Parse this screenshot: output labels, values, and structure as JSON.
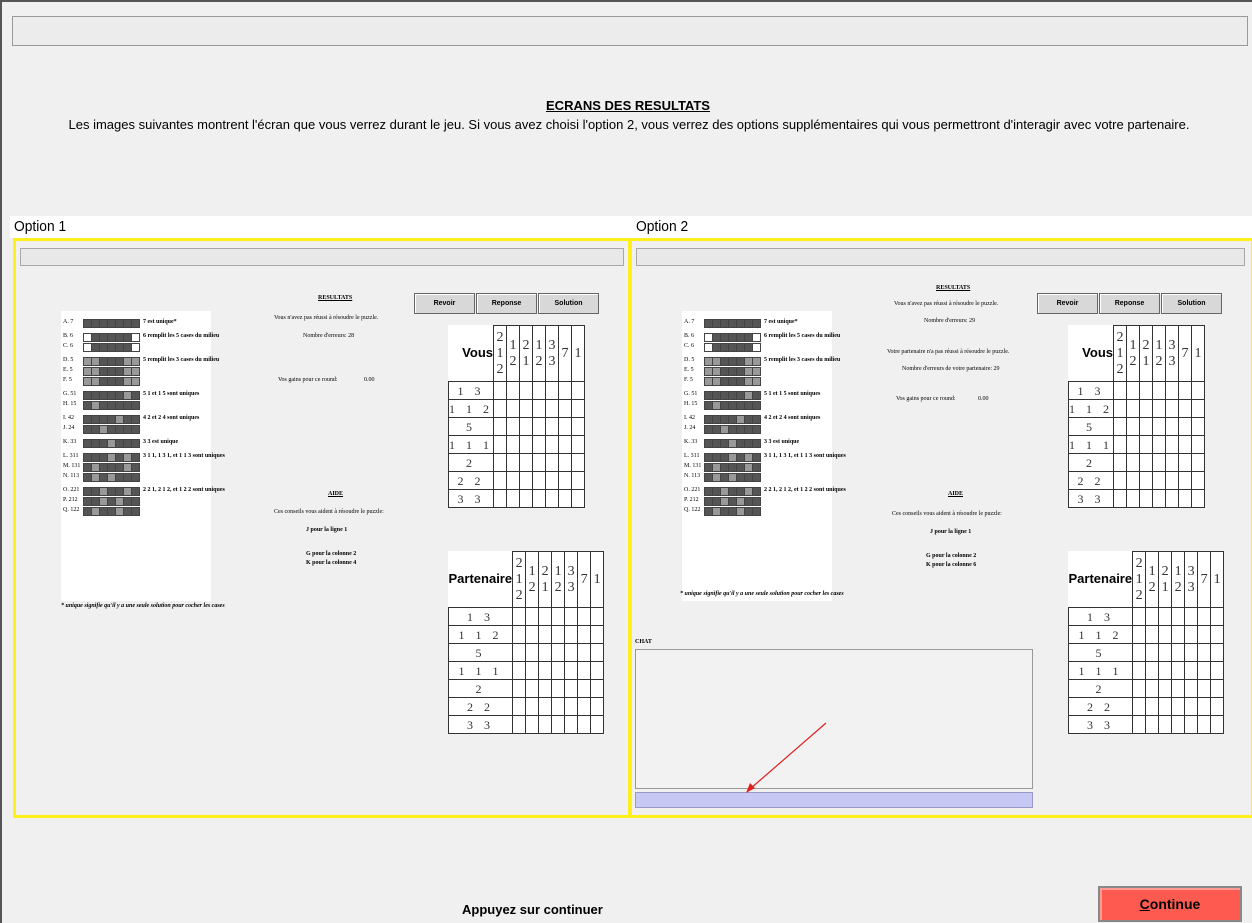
{
  "header": {
    "title": "ECRANS DES RESULTATS",
    "intro": "Les images suivantes montrent l'écran que vous verrez durant le jeu. Si vous avez choisi l'option 2, vous verrez des options supplémentaires qui vous permettront d'interagir avec votre partenaire."
  },
  "options": {
    "option1_label": "Option 1",
    "option2_label": "Option 2"
  },
  "screen": {
    "results_title": "RESULTATS",
    "not_solved": "Vous n'avez pas réussi à résoudre le puzzle.",
    "errors_label": "Nombre d'erreurs:",
    "errors_value_1": "28",
    "errors_value_2": "29",
    "partner_not_solved": "Votre partenaire n'a pas réussi à résoudre le puzzle.",
    "partner_errors": "Nombre d'erreurs de votre partenaire: 29",
    "earnings_label": "Vos gains pour ce round:",
    "earnings_value_1": "0.00",
    "earnings_value_2": "0.00",
    "aid_title": "AIDE",
    "aid_text": "Ces conseils vous aident à résoudre le puzzle:",
    "hint1": "J pour la ligne 1",
    "hint2": "G pour la colonne 2",
    "hint3_1": "K pour la colonne 4",
    "hint3_2": "K pour la colonne 6",
    "btn_review": "Revoir",
    "btn_response": "Reponse",
    "btn_solution": "Solution",
    "you_label": "Vous",
    "partner_label": "Partenaire",
    "chat_label": "CHAT",
    "footnote_1": "* unique signifie qu'il y a une seule solution pour cocher les cases",
    "footnote_2": "* unique signifie qu'il y a une seule solution pour cocher les cases"
  },
  "legend": [
    {
      "row": "A.",
      "num": "7",
      "desc": "7 est unique*"
    },
    {
      "row": "B.",
      "num": "6",
      "desc": "6 remplit les 5 cases du milieu"
    },
    {
      "row": "C.",
      "num": "6",
      "desc": ""
    },
    {
      "row": "D.",
      "num": "5",
      "desc": "5 remplit les 3 cases du milieu"
    },
    {
      "row": "E.",
      "num": "5",
      "desc": ""
    },
    {
      "row": "F.",
      "num": "5",
      "desc": ""
    },
    {
      "row": "G.",
      "num": "51",
      "desc": "5 1 et 1 5 sont uniques"
    },
    {
      "row": "H.",
      "num": "15",
      "desc": ""
    },
    {
      "row": "I.",
      "num": "42",
      "desc": "4 2 et 2 4 sont uniques"
    },
    {
      "row": "J.",
      "num": "24",
      "desc": ""
    },
    {
      "row": "K.",
      "num": "33",
      "desc": "3 3 est unique"
    },
    {
      "row": "L.",
      "num": "311",
      "desc": "3 1 1, 1 3 1, et 1 1 3 sont uniques"
    },
    {
      "row": "M.",
      "num": "131",
      "desc": ""
    },
    {
      "row": "N.",
      "num": "113",
      "desc": ""
    },
    {
      "row": "O.",
      "num": "221",
      "desc": "2 2 1, 2 1 2, et 1 2 2 sont uniques"
    },
    {
      "row": "P.",
      "num": "212",
      "desc": ""
    },
    {
      "row": "Q.",
      "num": "122",
      "desc": ""
    }
  ],
  "grid": {
    "col_top": [
      "2",
      "",
      "",
      "",
      "",
      "",
      ""
    ],
    "col_mid": [
      "1",
      "1",
      "2",
      "1",
      "3",
      "7",
      "1"
    ],
    "col_bot": [
      "2",
      "2",
      "1",
      "2",
      "3",
      "",
      ""
    ],
    "rows": [
      "1 3",
      "1 1 2",
      "5",
      "1 1 1",
      "2",
      "2 2",
      "3 3"
    ]
  },
  "footer": {
    "prompt": "Appuyez sur continuer",
    "continue": "Continue"
  }
}
